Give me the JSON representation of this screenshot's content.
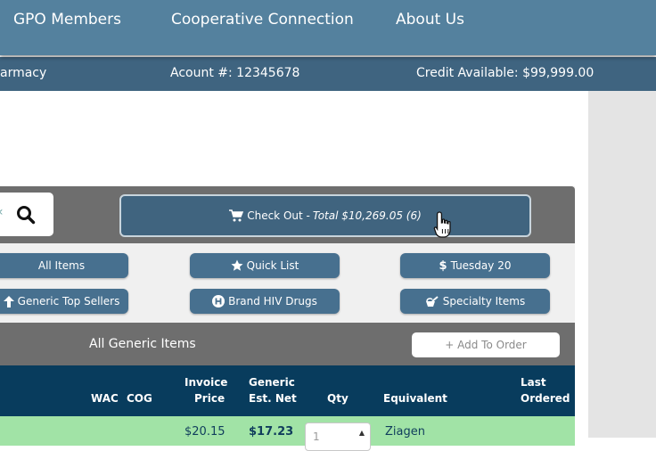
{
  "nav": {
    "gpo_members": "GPO Members",
    "cooperative_connection": "Cooperative Connection",
    "about_us": "About Us"
  },
  "infobar": {
    "pharmacy_label": "armacy",
    "account": "Acount #: 12345678",
    "credit": "Credit Available: $99,999.00"
  },
  "search": {
    "icon": "search-icon"
  },
  "checkout": {
    "label": "Check Out -",
    "total": "Total $10,269.05 (6)",
    "icon": "cart-icon"
  },
  "categories": [
    {
      "label": "All Items",
      "icon": ""
    },
    {
      "label": "Quick List",
      "icon": "star-icon"
    },
    {
      "label": "Tuesday 20",
      "icon": "dollar-icon"
    },
    {
      "label": "Generic Top Sellers",
      "icon": "arrow-up-icon"
    },
    {
      "label": "Brand HIV Drugs",
      "icon": "h-circle-icon"
    },
    {
      "label": "Specialty Items",
      "icon": "specialty-icon"
    }
  ],
  "section": {
    "title": "All Generic Items",
    "add_to_order": "+ Add To Order"
  },
  "table": {
    "headers": {
      "wac": "WAC",
      "cog": "COG",
      "invoice_price_1": "Invoice",
      "invoice_price_2": "Price",
      "generic_net_1": "Generic",
      "generic_net_2": "Est. Net",
      "qty": "Qty",
      "equivalent": "Equivalent",
      "last_ordered_1": "Last",
      "last_ordered_2": "Ordered"
    },
    "rows": [
      {
        "invoice_price": "$20.15",
        "generic_net": "$17.23",
        "qty": "1",
        "equivalent": "Ziagen"
      }
    ]
  },
  "colors": {
    "nav_bg": "#54819e",
    "infobar_bg": "#3f6480",
    "button_bg": "#47708f",
    "table_header_bg": "#083c5d",
    "row_highlight": "#a1e3a6"
  }
}
